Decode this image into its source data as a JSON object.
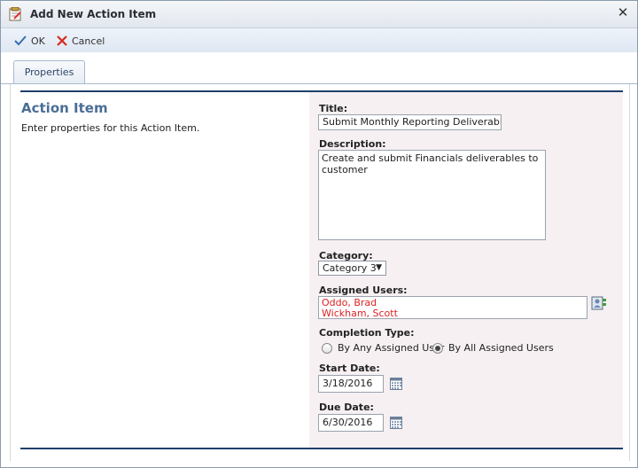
{
  "window": {
    "title": "Add New Action Item"
  },
  "toolbar": {
    "ok_label": "OK",
    "cancel_label": "Cancel"
  },
  "tabs": [
    {
      "label": "Properties"
    }
  ],
  "section": {
    "title": "Action Item",
    "description": "Enter properties for this Action Item."
  },
  "form": {
    "title_label": "Title:",
    "title_value": "Submit Monthly Reporting Deliverables",
    "description_label": "Description:",
    "description_value": "Create and submit Financials deliverables to customer",
    "category_label": "Category:",
    "category_value": "Category 3",
    "assigned_users_label": "Assigned Users:",
    "assigned_users": [
      "Oddo, Brad",
      "Wickham, Scott"
    ],
    "completion_type_label": "Completion Type:",
    "completion_options": [
      {
        "label": "By Any Assigned User",
        "selected": false
      },
      {
        "label": "By All Assigned Users",
        "selected": true
      }
    ],
    "start_date_label": "Start Date:",
    "start_date_value": "3/18/2016",
    "due_date_label": "Due Date:",
    "due_date_value": "6/30/2016"
  },
  "colors": {
    "accent_rule": "#1f3f6b",
    "section_title": "#4a6e96",
    "assigned_user_text": "#dd2222",
    "right_pane_bg": "#f6f0f2"
  }
}
